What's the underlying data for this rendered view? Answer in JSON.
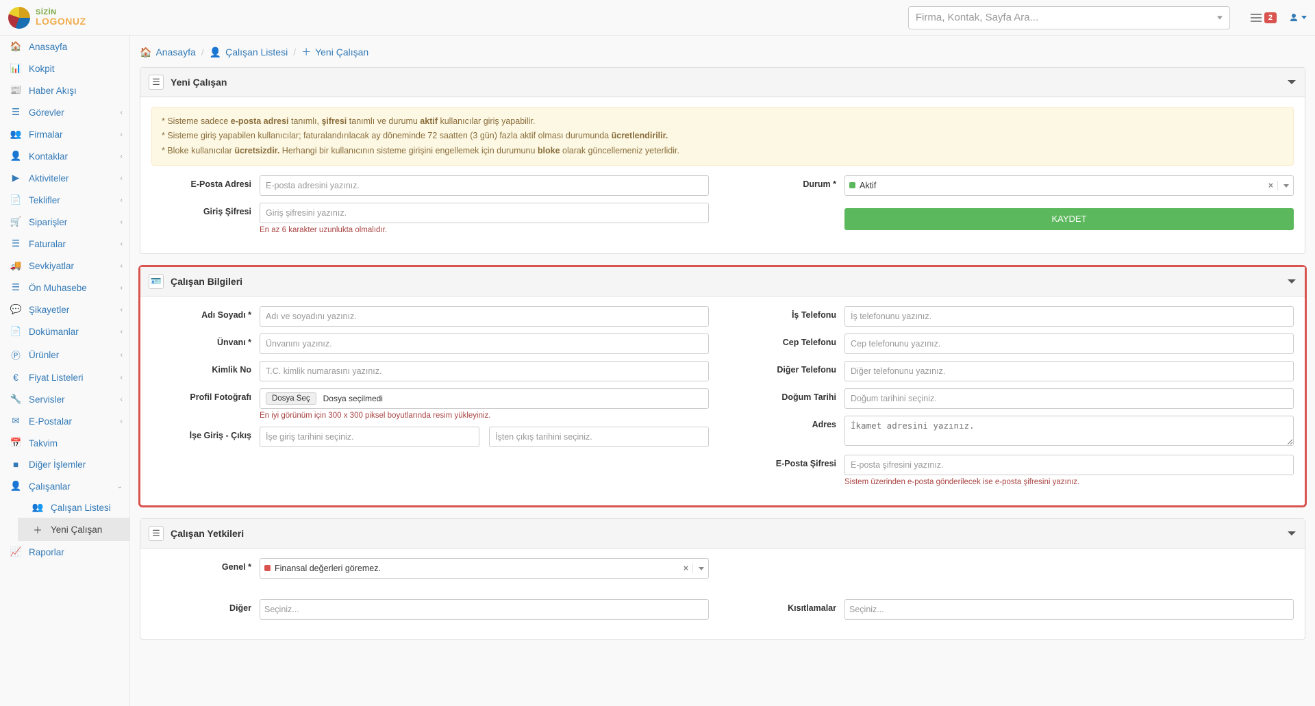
{
  "logo": {
    "line1": "SİZİN",
    "line2": "LOGONUZ"
  },
  "search": {
    "placeholder": "Firma, Kontak, Sayfa Ara..."
  },
  "topbar": {
    "notif_count": "2"
  },
  "sidebar": {
    "anasayfa": "Anasayfa",
    "kokpit": "Kokpit",
    "haber": "Haber Akışı",
    "gorevler": "Görevler",
    "firmalar": "Firmalar",
    "kontaklar": "Kontaklar",
    "aktiviteler": "Aktiviteler",
    "teklifler": "Teklifler",
    "siparisler": "Siparişler",
    "faturalar": "Faturalar",
    "sevkiyatlar": "Sevkiyatlar",
    "onmuhasebe": "Ön Muhasebe",
    "sikayetler": "Şikayetler",
    "dokumanlar": "Dokümanlar",
    "urunler": "Ürünler",
    "fiyat": "Fiyat Listeleri",
    "servisler": "Servisler",
    "epostalar": "E-Postalar",
    "takvim": "Takvim",
    "diger": "Diğer İşlemler",
    "calisanlar": "Çalışanlar",
    "calisan_listesi": "Çalışan Listesi",
    "yeni_calisan": "Yeni Çalışan",
    "raporlar": "Raporlar"
  },
  "breadcrumb": {
    "anasayfa": "Anasayfa",
    "calisan_listesi": "Çalışan Listesi",
    "yeni_calisan": "Yeni Çalışan"
  },
  "panel1": {
    "title": "Yeni Çalışan",
    "alert_parts": {
      "l1a": "* Sisteme sadece ",
      "l1b": "e-posta adresi",
      "l1c": " tanımlı, ",
      "l1d": "şifresi",
      "l1e": " tanımlı ve durumu ",
      "l1f": "aktif",
      "l1g": " kullanıcılar giriş yapabilir.",
      "l2a": "* Sisteme giriş yapabilen kullanıcılar; faturalandırılacak ay döneminde 72 saatten (3 gün) fazla aktif olması durumunda ",
      "l2b": "ücretlendirilir.",
      "l3a": "* Bloke kullanıcılar ",
      "l3b": "ücretsizdir.",
      "l3c": " Herhangi bir kullanıcının sisteme girişini engellemek için durumunu ",
      "l3d": "bloke",
      "l3e": " olarak güncellemeniz yeterlidir."
    },
    "email_label": "E-Posta Adresi",
    "email_ph": "E-posta adresini yazınız.",
    "pass_label": "Giriş Şifresi",
    "pass_ph": "Giriş şifresini yazınız.",
    "pass_help": "En az 6 karakter uzunlukta olmalıdır.",
    "durum_label": "Durum *",
    "durum_value": "Aktif",
    "save": "KAYDET"
  },
  "panel2": {
    "title": "Çalışan Bilgileri",
    "ad_label": "Adı Soyadı *",
    "ad_ph": "Adı ve soyadını yazınız.",
    "unvan_label": "Ünvanı *",
    "unvan_ph": "Ünvanını yazınız.",
    "kimlik_label": "Kimlik No",
    "kimlik_ph": "T.C. kimlik numarasını yazınız.",
    "foto_label": "Profil Fotoğrafı",
    "foto_btn": "Dosya Seç",
    "foto_txt": "Dosya seçilmedi",
    "foto_help": "En iyi görünüm için 300 x 300 piksel boyutlarında resim yükleyiniz.",
    "ise_label": "İşe Giriş - Çıkış",
    "ise_in_ph": "İşe giriş tarihini seçiniz.",
    "ise_out_ph": "İşten çıkış tarihini seçiniz.",
    "istel_label": "İş Telefonu",
    "istel_ph": "İş telefonunu yazınız.",
    "ceptel_label": "Cep Telefonu",
    "ceptel_ph": "Cep telefonunu yazınız.",
    "digertel_label": "Diğer Telefonu",
    "digertel_ph": "Diğer telefonunu yazınız.",
    "dogum_label": "Doğum Tarihi",
    "dogum_ph": "Doğum tarihini seçiniz.",
    "adres_label": "Adres",
    "adres_ph": "İkamet adresini yazınız.",
    "esifre_label": "E-Posta Şifresi",
    "esifre_ph": "E-posta şifresini yazınız.",
    "esifre_help": "Sistem üzerinden e-posta gönderilecek ise e-posta şifresini yazınız."
  },
  "panel3": {
    "title": "Çalışan Yetkileri",
    "genel_label": "Genel *",
    "genel_value": "Finansal değerleri göremez.",
    "diger_label": "Diğer",
    "diger_ph": "Seçiniz...",
    "kisit_label": "Kısıtlamalar",
    "kisit_ph": "Seçiniz..."
  }
}
